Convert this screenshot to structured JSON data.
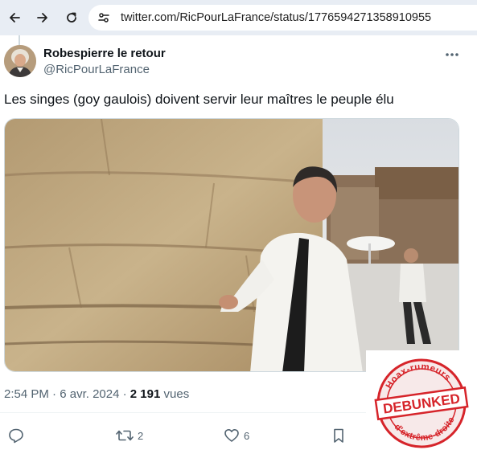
{
  "browser": {
    "url": "twitter.com/RicPourLaFrance/status/1776594271358910955"
  },
  "tweet": {
    "author_name": "Robespierre le retour",
    "author_handle": "@RicPourLaFrance",
    "text": "Les singes (goy gaulois) doivent servir leur maîtres le peuple élu",
    "time": "2:54 PM",
    "separator": "·",
    "date": "6 avr. 2024",
    "views_count": "2 191",
    "views_label": "vues"
  },
  "actions": {
    "reply_count": "",
    "retweet_count": "2",
    "like_count": "6"
  },
  "stamp": {
    "top_text": "Hoax-rumeurs",
    "center_text": "DEBUNKED",
    "bottom_text": "d'extrême-droite",
    "color": "#d6242a"
  },
  "colors": {
    "text_primary": "#0f1419",
    "text_secondary": "#536471",
    "browser_chrome": "#e8edf4"
  }
}
